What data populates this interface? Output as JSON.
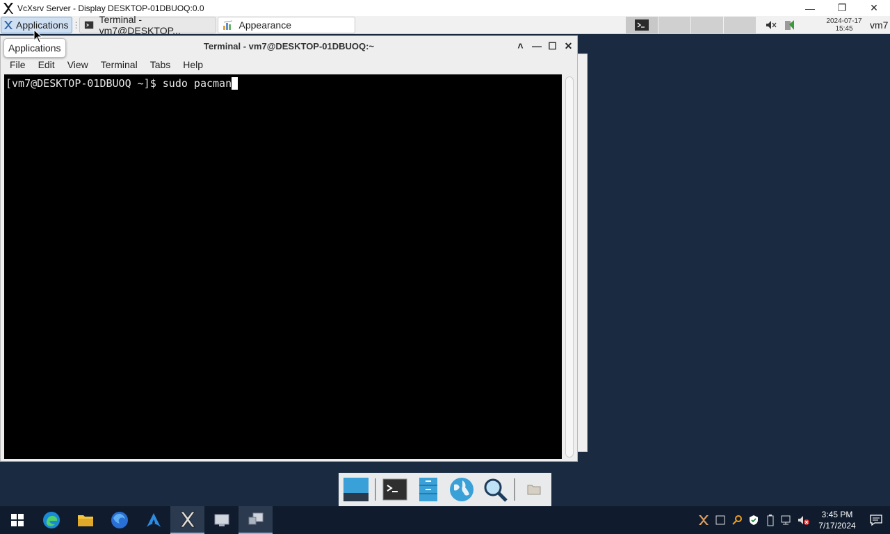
{
  "window": {
    "title": "VcXsrv Server - Display DESKTOP-01DBUOQ:0.0"
  },
  "panel": {
    "applications_label": "Applications",
    "tasks": [
      {
        "label": "Terminal - vm7@DESKTOP..."
      },
      {
        "label": "Appearance"
      }
    ],
    "clock_date": "2024-07-17",
    "clock_time": "15:45",
    "user": "vm7"
  },
  "tooltip": {
    "text": "Applications"
  },
  "terminal": {
    "title": "Terminal - vm7@DESKTOP-01DBUOQ:~",
    "menu": [
      "File",
      "Edit",
      "View",
      "Terminal",
      "Tabs",
      "Help"
    ],
    "prompt": "[vm7@DESKTOP-01DBUOQ ~]$ sudo pacman"
  },
  "win_taskbar": {
    "time": "3:45 PM",
    "date": "7/17/2024"
  }
}
